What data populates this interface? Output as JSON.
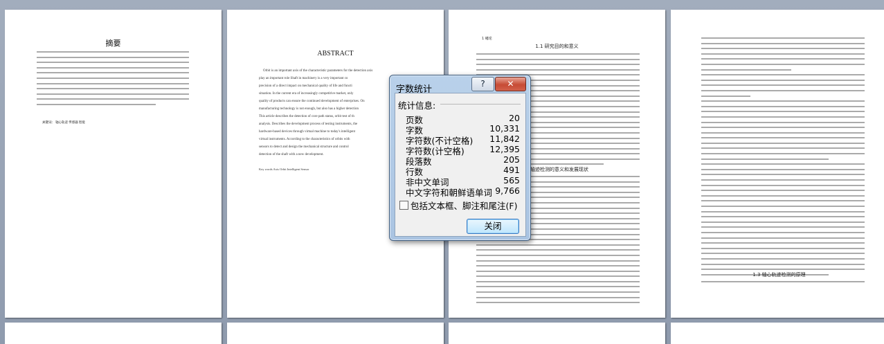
{
  "pages": {
    "p1": {
      "title": "摘要",
      "keywords": "关键词：   轴心轨迹   传感器   智能"
    },
    "p2": {
      "title": "ABSTRACT",
      "keywords": "Key words   Axis Orbit   Intelligent   Sensor",
      "lines": [
        "Orbit is an important axis of the characteristic parameters for the detection axis",
        "play an important role Shaft in machinery is a very important co",
        "precision of a direct impact on mechanical quality of life and functi",
        "situation. In the current era of increasingly competitive market, only",
        "quality of products can ensure the continued development of enterprises. On",
        "manufacturing technology is not enough, but also has a higher detection",
        "This article describes the detection of core path status, orbit test of th",
        "analysis. Describes the development process of testing instruments, the",
        "hardware-based devices through virtual machine to today's intelligent",
        "virtual instruments. According to the characteristics of orbits with",
        "sensors to detect and design the mechanical structure and control",
        "detection of the shaft with a new development."
      ]
    },
    "p3": {
      "page_no": "1 绪论",
      "heading1": "1.1  研究目的和意义",
      "heading2": "心轴迹检测的意义和发展现状"
    },
    "p4": {
      "heading": "1.3  轴心轨迹检测的原理"
    }
  },
  "dialog": {
    "title": "字数统计",
    "help": "?",
    "close_x": "✕",
    "stats_label": "统计信息:",
    "rows": [
      {
        "label": "页数",
        "value": "20"
      },
      {
        "label": "字数",
        "value": "10,331"
      },
      {
        "label": "字符数(不计空格)",
        "value": "11,842"
      },
      {
        "label": "字符数(计空格)",
        "value": "12,395"
      },
      {
        "label": "段落数",
        "value": "205"
      },
      {
        "label": "行数",
        "value": "491"
      },
      {
        "label": "非中文单词",
        "value": "565"
      },
      {
        "label": "中文字符和朝鲜语单词",
        "value": "9,766"
      }
    ],
    "checkbox_label": "包括文本框、脚注和尾注(F)",
    "checkbox_checked": false,
    "close_button": "关闭"
  }
}
